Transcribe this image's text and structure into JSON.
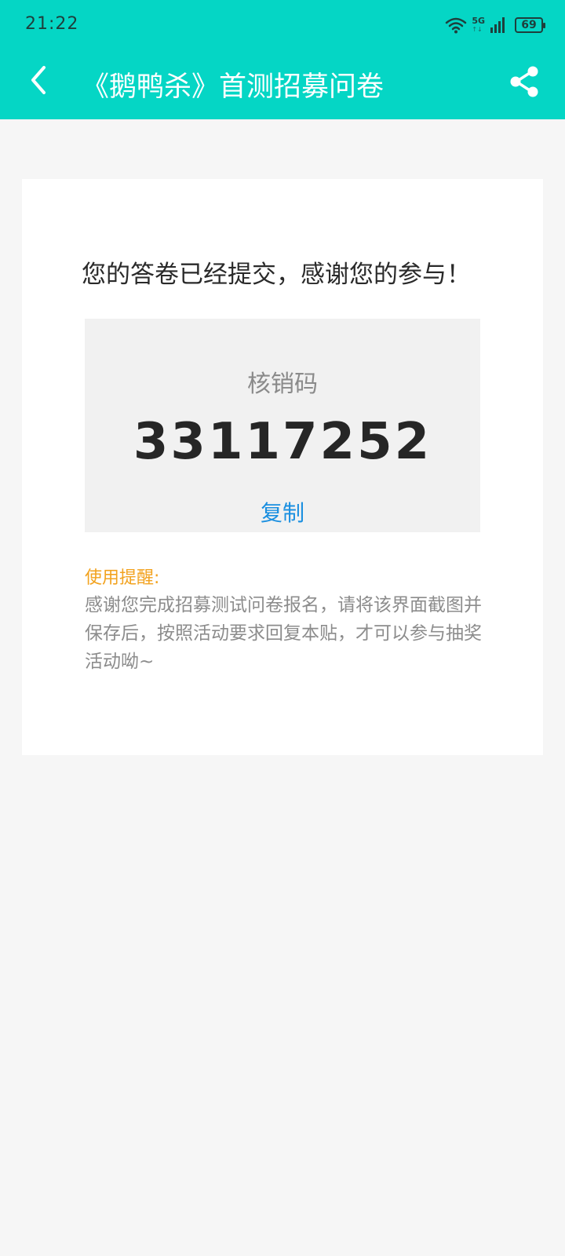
{
  "status_bar": {
    "time": "21:22",
    "network": "5G",
    "network_sub": "↑↓",
    "battery": "69"
  },
  "header": {
    "title": "《鹅鸭杀》首测招募问卷",
    "background_color": "#05d6c5",
    "back_icon": "chevron-left-icon",
    "share_icon": "share-icon"
  },
  "card": {
    "message": "您的答卷已经提交，感谢您的参与！",
    "code": {
      "label": "核销码",
      "value": "33117252",
      "copy_label": "复制"
    },
    "reminder": {
      "title": "使用提醒:",
      "body": "感谢您完成招募测试问卷报名，请将该界面截图并保存后，按照活动要求回复本贴，才可以参与抽奖活动呦~"
    }
  }
}
